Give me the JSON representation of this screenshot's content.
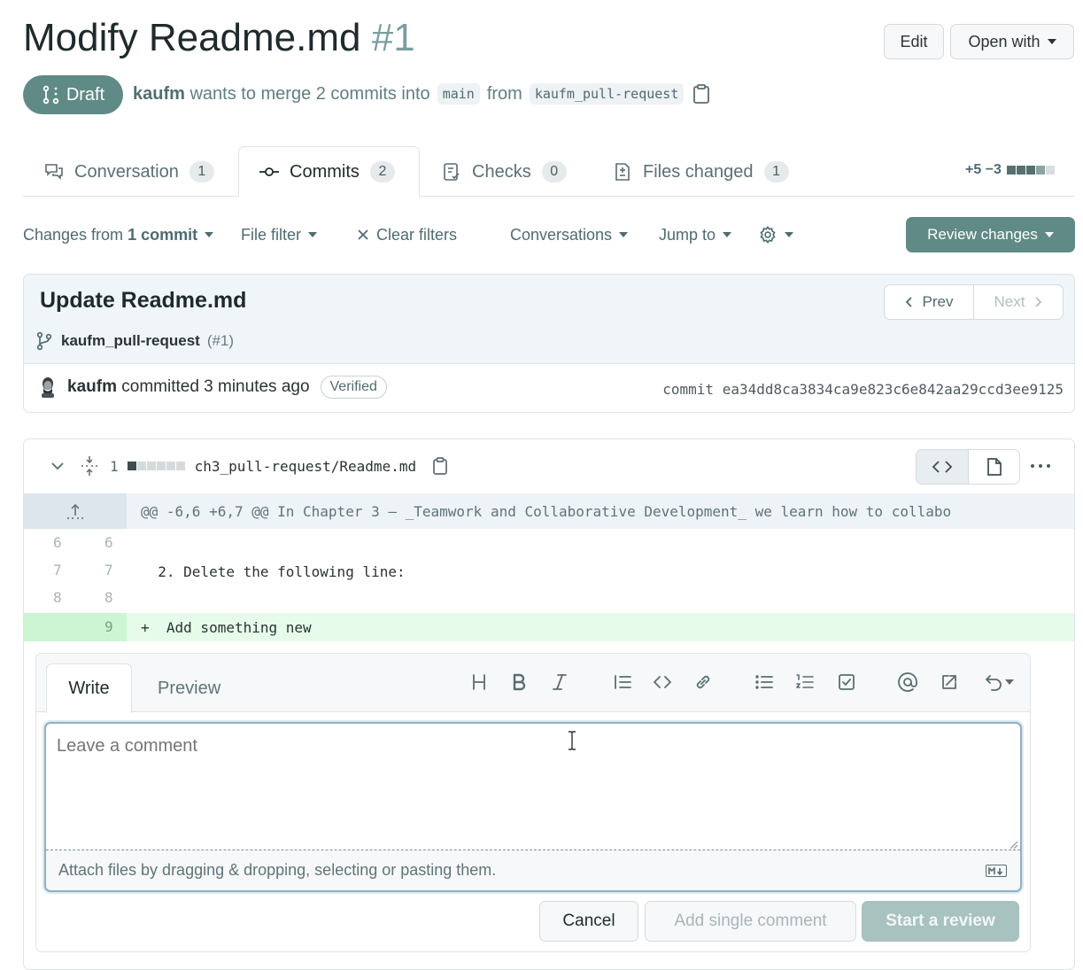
{
  "pr": {
    "title": "Modify Readme.md",
    "number": "#1",
    "status": "Draft",
    "author": "kaufm",
    "merge_text": "wants to merge 2 commits into",
    "base_branch": "main",
    "from_text": "from",
    "head_branch": "kaufm_pull-request"
  },
  "header_buttons": {
    "edit": "Edit",
    "open_with": "Open with"
  },
  "tabs": [
    {
      "label": "Conversation",
      "count": "1"
    },
    {
      "label": "Commits",
      "count": "2"
    },
    {
      "label": "Checks",
      "count": "0"
    },
    {
      "label": "Files changed",
      "count": "1"
    }
  ],
  "diffstat": {
    "additions": "+5",
    "deletions": "−3"
  },
  "filters": {
    "changes_prefix": "Changes from",
    "changes_value": "1 commit",
    "file_filter": "File filter",
    "clear_filters": "Clear filters",
    "conversations": "Conversations",
    "jump_to": "Jump to",
    "review_changes": "Review changes"
  },
  "commit": {
    "title": "Update Readme.md",
    "branch": "kaufm_pull-request",
    "pr_ref": "(#1)",
    "prev": "Prev",
    "next": "Next",
    "author": "kaufm",
    "committed_text": "committed 3 minutes ago",
    "verified": "Verified",
    "sha_label": "commit",
    "sha": "ea34dd8ca3834ca9e823c6e842aa29ccd3ee9125"
  },
  "file": {
    "change_count": "1",
    "path": "ch3_pull-request/Readme.md",
    "hunk_header": "@@ -6,6 +6,7 @@ In Chapter 3 – _Teamwork and Collaborative Development_ we learn how to collabo",
    "lines": [
      {
        "old": "6",
        "new": "6",
        "text": ""
      },
      {
        "old": "7",
        "new": "7",
        "text": "  2. Delete the following line:"
      },
      {
        "old": "8",
        "new": "8",
        "text": ""
      },
      {
        "old": "",
        "new": "9",
        "text": "+  Add something new"
      }
    ]
  },
  "comment": {
    "write_tab": "Write",
    "preview_tab": "Preview",
    "placeholder": "Leave a comment",
    "attach_text": "Attach files by dragging & dropping, selecting or pasting them.",
    "cancel": "Cancel",
    "add_single": "Add single comment",
    "start_review": "Start a review"
  },
  "colors": {
    "accent": "#5f8a85",
    "added_bg": "#e6fbe9",
    "added_gutter": "#ccf5d4",
    "hunk_bg": "#eef3f7"
  },
  "icons": [
    "draft-pr-icon",
    "copy-icon",
    "conversation-icon",
    "commit-icon",
    "checks-icon",
    "file-diff-icon",
    "gear-icon",
    "close-icon",
    "chevron-left-icon",
    "chevron-right-icon",
    "branch-icon",
    "avatar",
    "chevron-down-icon",
    "expand-icon",
    "code-icon",
    "file-icon",
    "kebab-icon",
    "heading-icon",
    "bold-icon",
    "italic-icon",
    "quote-icon",
    "link-icon",
    "unordered-list-icon",
    "ordered-list-icon",
    "tasklist-icon",
    "mention-icon",
    "reference-icon",
    "undo-icon",
    "markdown-icon"
  ]
}
